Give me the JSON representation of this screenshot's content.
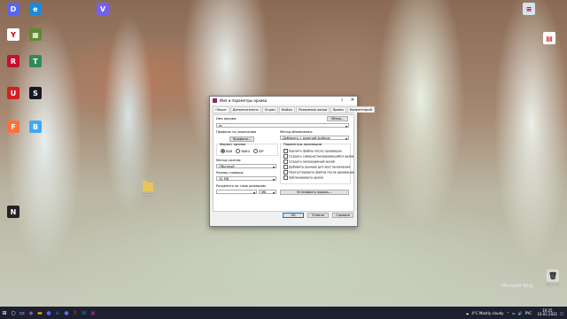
{
  "desktop": {
    "left_icons": [
      {
        "name": "Discord",
        "color": "#5865f2",
        "glyph": "D"
      },
      {
        "name": "Microsoft Edge",
        "color": "#1d8ad6",
        "glyph": "e"
      },
      {
        "name": "Yandex",
        "color": "#ffffff",
        "glyph": "Y"
      },
      {
        "name": "Minecraft",
        "color": "#5c8a2e",
        "glyph": "▦"
      },
      {
        "name": "Ring",
        "color": "#c8102e",
        "glyph": "R"
      },
      {
        "name": "Terraria",
        "color": "#2e8b57",
        "glyph": "T"
      },
      {
        "name": "Uplay",
        "color": "#d42020",
        "glyph": "U"
      },
      {
        "name": "Steam",
        "color": "#171a21",
        "glyph": "S"
      },
      {
        "name": "Firefox",
        "color": "#ff7139",
        "glyph": "F"
      },
      {
        "name": "BlueStacks",
        "color": "#3fa9f5",
        "glyph": "B"
      },
      {
        "name": "NVIDIA",
        "color": "#222",
        "glyph": "N"
      }
    ],
    "top_icons": [
      {
        "name": "Viber",
        "color": "#7360f2",
        "glyph": "V"
      }
    ],
    "right_icons": [
      {
        "name": "Notepad",
        "color": "#d8e2ee",
        "glyph": "≡"
      },
      {
        "name": "Document",
        "color": "#ffffff",
        "glyph": "▤"
      }
    ],
    "folder_label": "Новая",
    "recycle_label": "Корзина",
    "watermark": "Microsoft Bing"
  },
  "window": {
    "title": "Имя и параметры архива",
    "help": "?",
    "close": "✕",
    "tabs": [
      "Общие",
      "Дополнительно",
      "Опции",
      "Файлы",
      "Резервные копии",
      "Время",
      "Комментарий"
    ],
    "archive_name_label": "Имя архива:",
    "archive_name_value": "ес",
    "browse_label": "Обзор...",
    "profiles_label": "Профиль по умолчанию",
    "profiles_button": "Профили...",
    "update_method_label": "Метод обновления:",
    "update_method_value": "Добавить с заменой файлов",
    "format_label": "Формат архива",
    "formats": [
      "RAR",
      "RAR4",
      "ZIP"
    ],
    "format_selected": "RAR",
    "compression_label": "Метод сжатия:",
    "compression_value": "Обычный",
    "dict_label": "Размер словаря:",
    "dict_value": "32 МБ",
    "split_label": "Разделить на тома размером:",
    "split_unit": "МБ",
    "options_label": "Параметры архивации",
    "options": [
      "Удалить файлы после архивации",
      "Создать самораспаковывающийся архив",
      "Создать непрерывный архив",
      "Добавить данные для восстановления",
      "Протестировать файлы после архивации",
      "Заблокировать архив"
    ],
    "password_button": "Установить пароль...",
    "ok": "OK",
    "cancel": "Отмена",
    "help_button": "Справка"
  },
  "taskbar": {
    "weather": "4°C  Mostly cloudy",
    "lang": "РУС",
    "time": "19:25",
    "date": "10.02.2021"
  }
}
